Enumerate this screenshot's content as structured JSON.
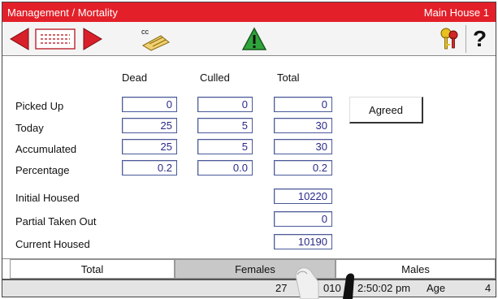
{
  "titlebar": {
    "left": "Management / Mortality",
    "right": "Main House 1"
  },
  "toolbar": {
    "cc_label": "cc",
    "help_label": "?"
  },
  "columns": {
    "dead": "Dead",
    "culled": "Culled",
    "total": "Total"
  },
  "rows": {
    "picked_up": {
      "label": "Picked Up",
      "dead": "0",
      "culled": "0",
      "total": "0"
    },
    "today": {
      "label": "Today",
      "dead": "25",
      "culled": "5",
      "total": "30"
    },
    "accumulated": {
      "label": "Accumulated",
      "dead": "25",
      "culled": "5",
      "total": "30"
    },
    "percentage": {
      "label": "Percentage",
      "dead": "0.2",
      "culled": "0.0",
      "total": "0.2"
    }
  },
  "housing": {
    "initial": {
      "label": "Initial Housed",
      "value": "10220"
    },
    "partial": {
      "label": "Partial Taken Out",
      "value": "0"
    },
    "current": {
      "label": "Current Housed",
      "value": "10190"
    }
  },
  "agreed_label": "Agreed",
  "tabs": {
    "total": "Total",
    "females": "Females",
    "males": "Males"
  },
  "status": {
    "date": "27",
    "year_fragment": "010",
    "time": "2:50:02 pm",
    "age_label": "Age",
    "age_value": "4"
  },
  "colors": {
    "title_red": "#e3202a",
    "arrow_red": "#d8202a",
    "field_text": "#2a2a8a"
  }
}
